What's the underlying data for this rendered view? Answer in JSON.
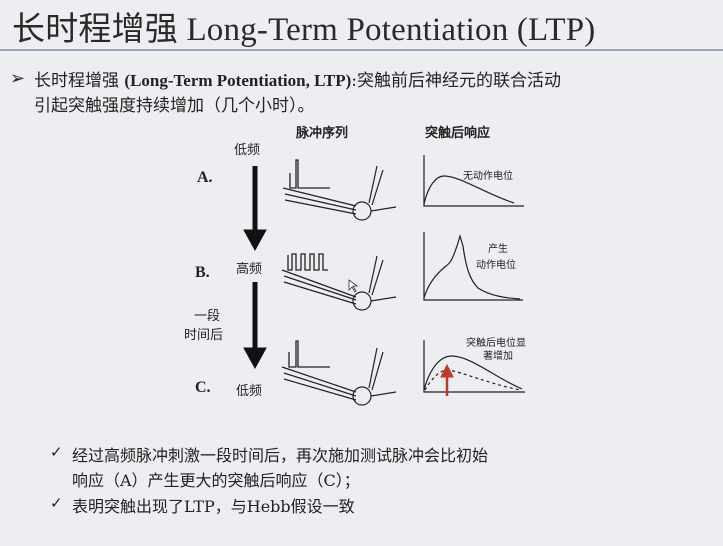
{
  "slide": {
    "title": "长时程增强 Long-Term Potentiation (LTP)",
    "bullet": {
      "prefix": "长时程增强",
      "term": "(Long-Term Potentiation, LTP)",
      "text_rest": ":突触前后神经元的联合活动",
      "line2": "引起突触强度持续增加（几个小时）。"
    }
  },
  "figure": {
    "col_pulse": "脉冲序列",
    "col_response": "突触后响应",
    "rows": [
      {
        "letter": "A.",
        "freq": "低频",
        "note": "无动作电位"
      },
      {
        "letter": "B.",
        "freq": "高频",
        "note_line1": "产生",
        "note_line2": "动作电位"
      },
      {
        "letter": "C.",
        "freq": "低频",
        "note_line1": "突触后电位显",
        "note_line2": "著增加"
      }
    ],
    "top_freq": "低频",
    "interval_line1": "一段",
    "interval_line2": "时间后"
  },
  "conclusions": [
    {
      "line1": "经过高频脉冲刺激一段时间后，再次施加测试脉冲会比初始",
      "line2": "响应（A）产生更大的突触后响应（C）；"
    },
    {
      "line1": "表明突触出现了LTP，与Hebb假设一致"
    }
  ],
  "colors": {
    "accent_arrow": "#c0392b",
    "rule": "#9aa3b4"
  }
}
